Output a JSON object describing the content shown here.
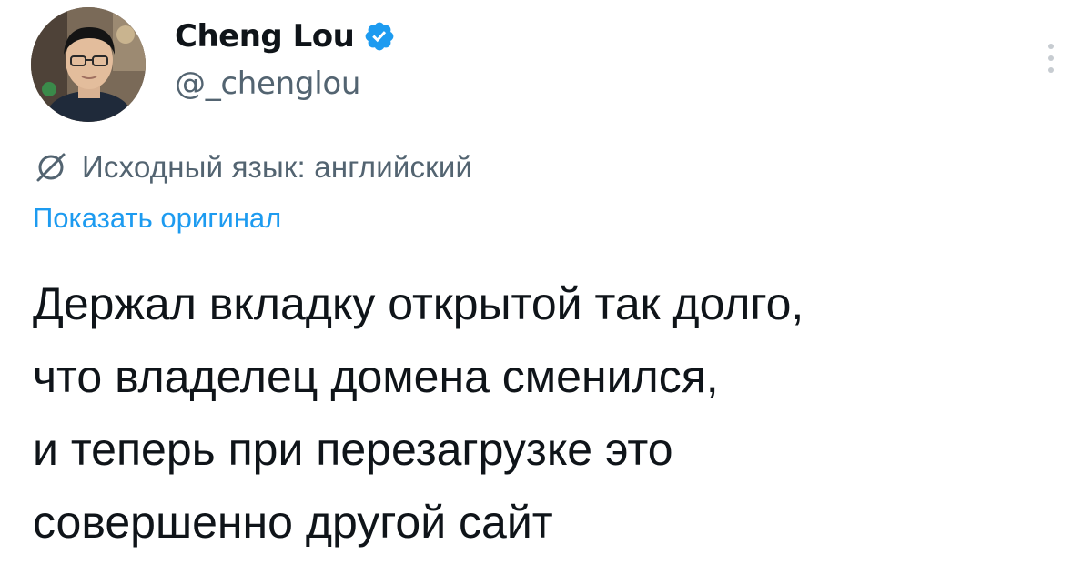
{
  "author": {
    "display_name": "Cheng Lou",
    "handle": "@_chenglou",
    "verified": true,
    "verified_color": "#1d9bf0"
  },
  "icons": {
    "avatar": "profile-photo",
    "verified": "verified-badge-icon",
    "more": "more-vertical-icon",
    "translate": "translate-globe-icon"
  },
  "translation": {
    "notice": "Исходный язык: английский",
    "show_original": "Показать оригинал"
  },
  "tweet": {
    "lines": [
      "Держал вкладку открытой так долго,",
      "что владелец домена сменился,",
      "и теперь при перезагрузке это",
      "совершенно другой сайт"
    ]
  },
  "colors": {
    "text_primary": "#0f1419",
    "text_secondary": "#536471",
    "link": "#1d9bf0"
  }
}
